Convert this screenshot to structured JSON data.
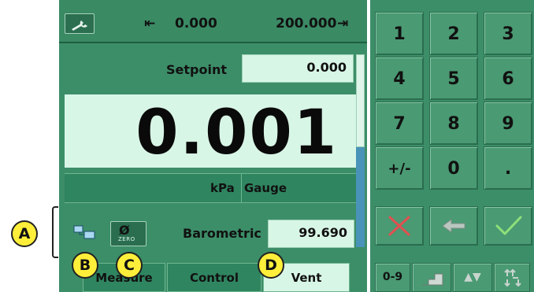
{
  "header": {
    "min_arrow": "⇤",
    "min_value": "0.000",
    "max_value": "200.000",
    "max_arrow": "⇥"
  },
  "setpoint": {
    "label": "Setpoint",
    "value": "0.000"
  },
  "reading": {
    "value": "0.001"
  },
  "units": {
    "unit": "kPa",
    "mode": "Gauge"
  },
  "barometric": {
    "label": "Barometric",
    "value": "99.690"
  },
  "zero_button": {
    "glyph": "Ø",
    "text": "ZERO"
  },
  "tabs": [
    {
      "label": "Measure"
    },
    {
      "label": "Control"
    },
    {
      "label": "Vent"
    }
  ],
  "keypad": {
    "keys": [
      "1",
      "2",
      "3",
      "4",
      "5",
      "6",
      "7",
      "8",
      "9",
      "+/-",
      "0",
      "."
    ],
    "mode_label": "0-9",
    "arrows_label": "▲▼"
  },
  "callouts": [
    "A",
    "B",
    "C",
    "D"
  ],
  "colors": {
    "panel_green": "#3c8e68",
    "field_light": "#d8f6e6",
    "callout_yellow": "#ffef3a",
    "cancel_red": "#e05050",
    "accept_green": "#8ee07a"
  }
}
